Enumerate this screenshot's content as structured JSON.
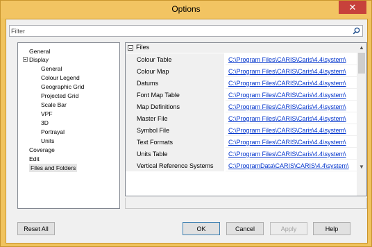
{
  "window": {
    "title": "Options",
    "close_glyph": "✕"
  },
  "filter": {
    "placeholder": "Filter",
    "value": ""
  },
  "tree": {
    "items": [
      {
        "label": "General"
      },
      {
        "label": "Display",
        "expanded": true
      },
      {
        "label": "General"
      },
      {
        "label": "Colour Legend"
      },
      {
        "label": "Geographic Grid"
      },
      {
        "label": "Projected Grid"
      },
      {
        "label": "Scale Bar"
      },
      {
        "label": "VPF"
      },
      {
        "label": "3D"
      },
      {
        "label": "Portrayal"
      },
      {
        "label": "Units"
      },
      {
        "label": "Coverage"
      },
      {
        "label": "Edit"
      },
      {
        "label": "Files and Folders",
        "selected": true
      }
    ]
  },
  "grid": {
    "section": "Files",
    "rows": [
      {
        "name": "Colour Table",
        "value": "C:\\Program Files\\CARIS\\Caris\\4.4\\system\\"
      },
      {
        "name": "Colour Map",
        "value": "C:\\Program Files\\CARIS\\Caris\\4.4\\system\\"
      },
      {
        "name": "Datums",
        "value": "C:\\Program Files\\CARIS\\Caris\\4.4\\system\\"
      },
      {
        "name": "Font Map Table",
        "value": "C:\\Program Files\\CARIS\\Caris\\4.4\\system\\"
      },
      {
        "name": "Map Definitions",
        "value": "C:\\Program Files\\CARIS\\Caris\\4.4\\system\\"
      },
      {
        "name": "Master File",
        "value": "C:\\Program Files\\CARIS\\Caris\\4.4\\system\\"
      },
      {
        "name": "Symbol File",
        "value": "C:\\Program Files\\CARIS\\Caris\\4.4\\system\\"
      },
      {
        "name": "Text Formats",
        "value": "C:\\Program Files\\CARIS\\Caris\\4.4\\system\\"
      },
      {
        "name": "Units Table",
        "value": "C:\\Program Files\\CARIS\\Caris\\4.4\\system\\"
      },
      {
        "name": "Vertical Reference Systems",
        "value": "C:\\ProgramData\\CARIS\\CARIS\\4.4\\system\\"
      }
    ]
  },
  "buttons": {
    "reset_all": "Reset All",
    "ok": "OK",
    "cancel": "Cancel",
    "apply": "Apply",
    "help": "Help"
  }
}
